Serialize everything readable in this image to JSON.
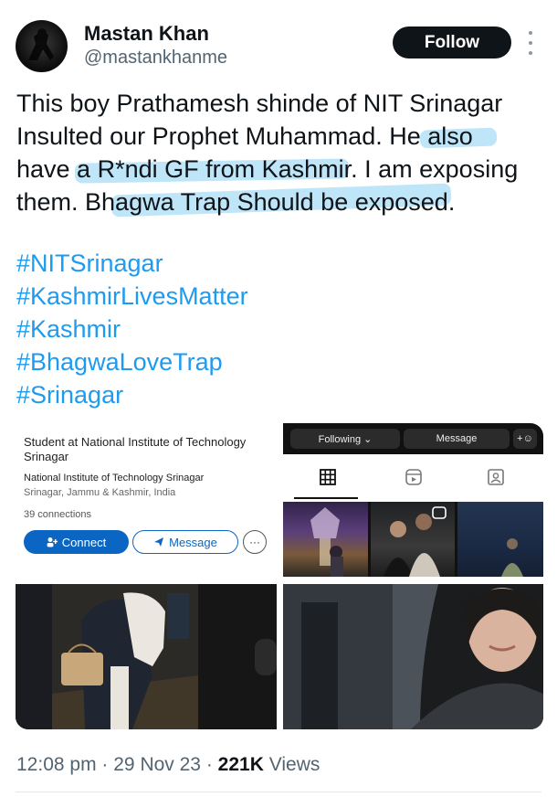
{
  "author": {
    "name": "Mastan Khan",
    "handle": "@mastankhanme",
    "avatar_icon": "avatar-silhouette-icon"
  },
  "follow_label": "Follow",
  "tweet": {
    "lines": [
      "This boy Prathamesh shinde of NIT Srinagar",
      "Insulted our Prophet Muhammad. He also",
      "have a R*ndi GF from Kashmir. I am exposing",
      "them. Bhagwa Trap Should be exposed."
    ],
    "hashtags": [
      "#NITSrinagar",
      "#KashmirLivesMatter",
      "#Kashmir",
      "#BhagwaLoveTrap",
      "#Srinagar"
    ],
    "highlight_color": "#a8dcf5",
    "hashtag_color": "#1d9bf0"
  },
  "linkedin_card": {
    "title": "Student at National Institute of Technology Srinagar",
    "organization": "National Institute of Technology Srinagar",
    "location": "Srinagar, Jammu & Kashmir, India",
    "connections": "39 connections",
    "connect_label": "Connect",
    "message_label": "Message",
    "more_label": "···",
    "accent": "#0a66c2"
  },
  "instagram_card": {
    "following_label": "Following ⌄",
    "message_label": "Message",
    "add_person_label": "+☺",
    "tabs": [
      "grid-icon",
      "reels-icon",
      "tagged-icon"
    ]
  },
  "meta": {
    "time": "12:08 pm",
    "separator": "·",
    "date": "29 Nov 23",
    "views_count": "221K",
    "views_label": "Views"
  }
}
